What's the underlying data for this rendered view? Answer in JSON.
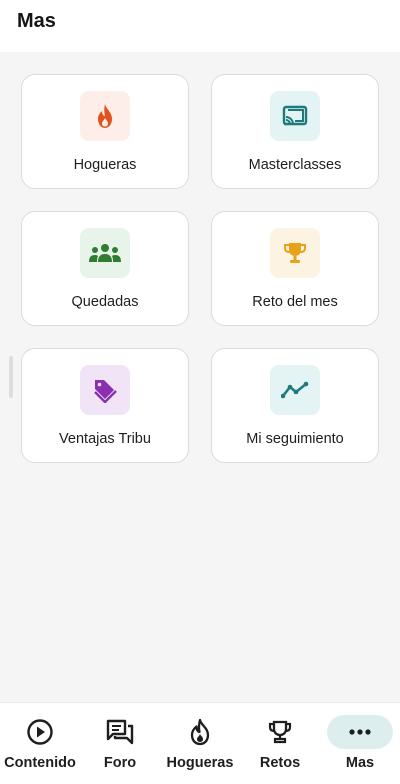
{
  "header": {
    "title": "Mas"
  },
  "cards": [
    {
      "label": "Hogueras",
      "icon": "flame-icon",
      "bg": "#fdeee9",
      "fg": "#e0531c"
    },
    {
      "label": "Masterclasses",
      "icon": "cast-screen-icon",
      "bg": "#e4f3f3",
      "fg": "#1e7b7b"
    },
    {
      "label": "Quedadas",
      "icon": "group-icon",
      "bg": "#e8f3ea",
      "fg": "#2e7d32"
    },
    {
      "label": "Reto del mes",
      "icon": "trophy-icon",
      "bg": "#fdf3e2",
      "fg": "#e8a21a"
    },
    {
      "label": "Ventajas Tribu",
      "icon": "tags-icon",
      "bg": "#f1e4f6",
      "fg": "#8a2fb0"
    },
    {
      "label": "Mi seguimiento",
      "icon": "trend-line-icon",
      "bg": "#e4f3f3",
      "fg": "#1e7b7b"
    }
  ],
  "nav": [
    {
      "label": "Contenido",
      "icon": "play-circle-icon",
      "active": false
    },
    {
      "label": "Foro",
      "icon": "chat-bubbles-icon",
      "active": false
    },
    {
      "label": "Hogueras",
      "icon": "flame-outline-icon",
      "active": false
    },
    {
      "label": "Retos",
      "icon": "trophy-outline-icon",
      "active": false
    },
    {
      "label": "Mas",
      "icon": "more-dots-icon",
      "active": true
    }
  ],
  "colors": {
    "active_nav_bg": "#dcefee",
    "background": "#f5f5f5"
  }
}
